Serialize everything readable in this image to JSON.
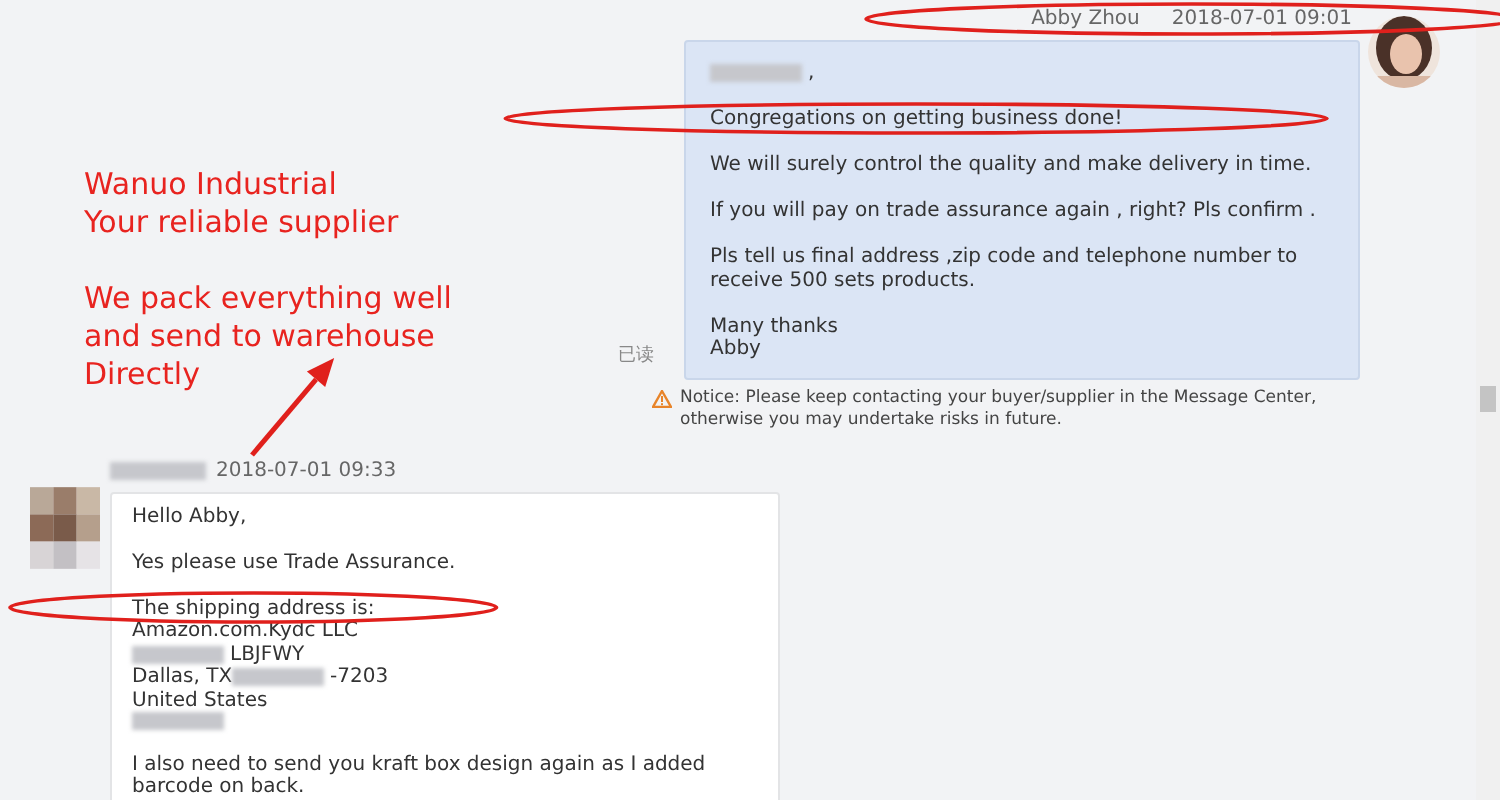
{
  "annotation": {
    "lines": [
      "Wanuo Industrial",
      "Your reliable supplier"
    ],
    "lines_2": [
      "We pack everything well",
      "and send to warehouse",
      "Directly"
    ]
  },
  "outgoing": {
    "sender": "Abby Zhou",
    "time": "2018-07-01 09:01",
    "read_receipt": "已读",
    "paragraphs": [
      [
        [
          {
            "kind": "redacted"
          },
          {
            "kind": "text",
            "text": ","
          }
        ]
      ],
      [
        [
          {
            "kind": "text",
            "text": "Congregations on getting business done!"
          }
        ]
      ],
      [
        [
          {
            "kind": "text",
            "text": "We will surely control the quality and make delivery in time."
          }
        ]
      ],
      [
        [
          {
            "kind": "text",
            "text": "If you will pay on trade assurance again , right? Pls confirm ."
          }
        ]
      ],
      [
        [
          {
            "kind": "text",
            "text": "Pls tell us final address ,zip code and telephone number to"
          }
        ],
        [
          {
            "kind": "text",
            "text": "receive 500 sets products."
          }
        ]
      ],
      [
        [
          {
            "kind": "text",
            "text": "Many thanks"
          }
        ],
        [
          {
            "kind": "text",
            "text": "Abby"
          }
        ]
      ]
    ],
    "notice": "Notice: Please keep contacting your buyer/supplier in the Message Center, otherwise you may undertake risks in future."
  },
  "incoming": {
    "time": "2018-07-01 09:33",
    "paragraphs": [
      [
        [
          {
            "kind": "text",
            "text": "Hello Abby,"
          }
        ]
      ],
      [
        [
          {
            "kind": "text",
            "text": "Yes please use Trade Assurance."
          }
        ]
      ],
      [
        [
          {
            "kind": "text",
            "text": "The shipping address is:"
          }
        ],
        [
          {
            "kind": "text",
            "text": "Amazon.com.Kydc LLC"
          }
        ],
        [
          {
            "kind": "redacted"
          },
          {
            "kind": "text",
            "text": "LBJFWY"
          }
        ],
        [
          {
            "kind": "text",
            "text": "Dallas, TX"
          },
          {
            "kind": "redacted"
          },
          {
            "kind": "text",
            "text": "-7203"
          }
        ],
        [
          {
            "kind": "text",
            "text": "United States"
          }
        ],
        [
          {
            "kind": "redacted"
          }
        ]
      ],
      [
        [
          {
            "kind": "text",
            "text": "I also need to send you kraft box design again as I added"
          }
        ],
        [
          {
            "kind": "text",
            "text": "barcode on back."
          }
        ]
      ]
    ]
  }
}
